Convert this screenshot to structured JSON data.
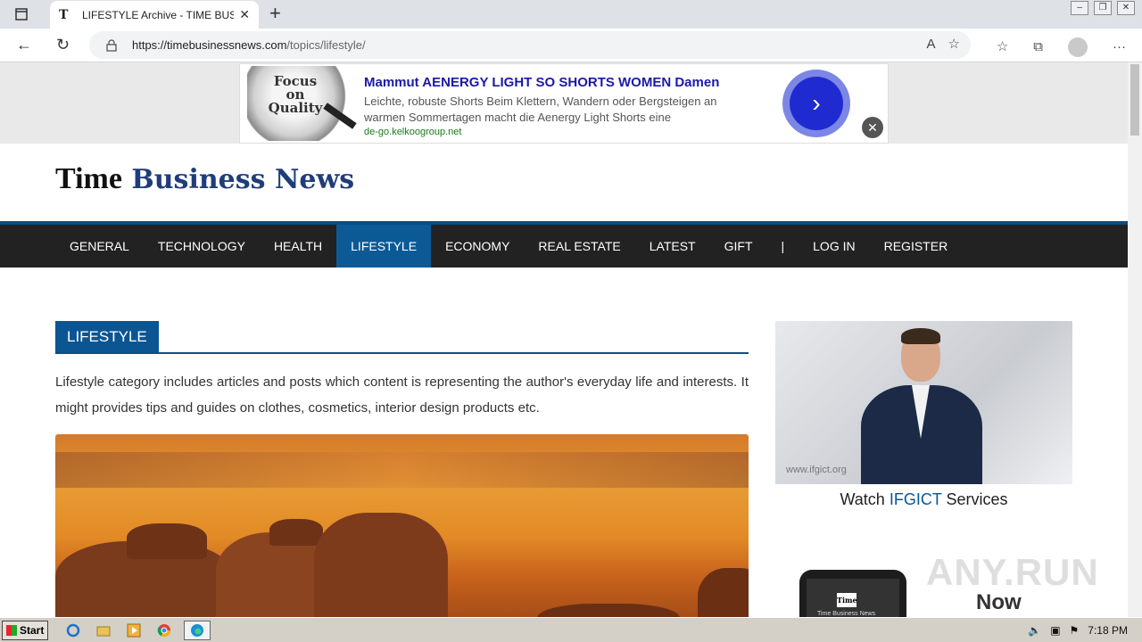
{
  "browser": {
    "tab_title": "LIFESTYLE Archive - TIME BUSIN",
    "favicon": "T",
    "url_host": "https://timebusinessnews.com",
    "url_path": "/topics/lifestyle/",
    "new_tab": "+",
    "tab_close": "✕",
    "back": "←",
    "reload": "↻",
    "read_aloud": "A",
    "add_favorite": "☆",
    "favorites": "☆",
    "collections": "⧉",
    "more": "···",
    "window_controls": {
      "minimize": "–",
      "restore": "❐",
      "close": "✕"
    }
  },
  "ad": {
    "image_text": "Focus on Quality",
    "title": "Mammut AENERGY LIGHT SO SHORTS WOMEN Damen",
    "description": "Leichte, robuste Shorts Beim Klettern, Wandern oder Bergsteigen an warmen Sommertagen macht die Aenergy Light Shorts eine",
    "url": "de-go.kelkoogroup.net",
    "go": "›",
    "close": "✕"
  },
  "site": {
    "logo_part1": "Time",
    "logo_part2": "Business News"
  },
  "nav": {
    "items": [
      "GENERAL",
      "TECHNOLOGY",
      "HEALTH",
      "LIFESTYLE",
      "ECONOMY",
      "REAL ESTATE",
      "LATEST",
      "GIFT",
      "|",
      "LOG IN",
      "REGISTER"
    ],
    "active": "LIFESTYLE"
  },
  "content": {
    "section_title": "LIFESTYLE",
    "intro": "Lifestyle category includes articles and posts which content is representing the author's everyday life and interests. It might provides tips and guides on clothes, cosmetics, interior design products etc."
  },
  "sidebar": {
    "video_watermark": "www.ifgict.org",
    "watch_prefix": "Watch ",
    "watch_brand": "IFGICT",
    "watch_suffix": " Services",
    "phone_logo": "Time",
    "phone_name": "Time Business News",
    "now_label": "Now",
    "anyrun_watermark": "ANY.RUN"
  },
  "taskbar": {
    "start": "Start",
    "clock": "7:18 PM",
    "apps": [
      "ie-icon",
      "folder-icon",
      "media-icon",
      "chrome-icon",
      "edge-icon"
    ]
  },
  "colors": {
    "nav_bg": "#222222",
    "nav_active": "#0b5a96",
    "brand_blue": "#1f3d7a",
    "ad_title": "#1a1aa8"
  }
}
